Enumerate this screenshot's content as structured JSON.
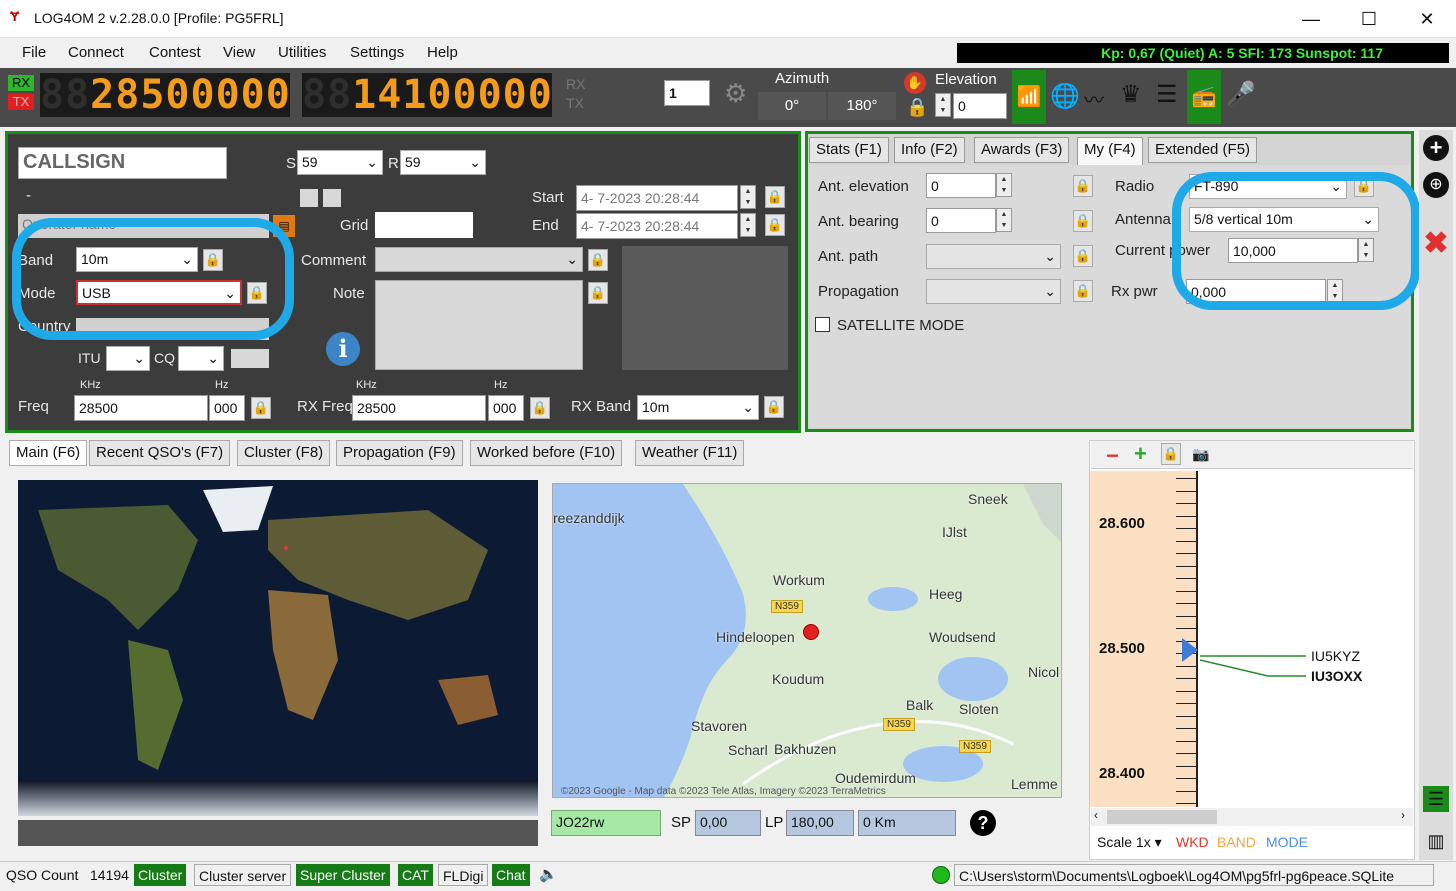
{
  "window": {
    "title": "LOG4OM 2 v.2.28.0.0 [Profile: PG5FRL]",
    "minimize": "—",
    "maximize": "☐",
    "close": "✕"
  },
  "menu": [
    "File",
    "Connect",
    "Contest",
    "View",
    "Utilities",
    "Settings",
    "Help"
  ],
  "propagation_bar": "Kp: 0,67 (Quiet)  A: 5  SFI: 173 Sunspot: 117",
  "radio": {
    "rx_label": "RX",
    "tx_label": "TX",
    "rx_freq_ghost": "88",
    "rx_freq": "28500000",
    "tx_freq_ghost": "88",
    "tx_freq": "14100000",
    "rx_indicator": "RX",
    "tx_indicator": "TX",
    "radio_number": "1",
    "azimuth_label": "Azimuth",
    "azimuth_sp": "0°",
    "azimuth_lp": "180°",
    "elevation_label": "Elevation",
    "elevation_value": "0"
  },
  "qso": {
    "callsign_placeholder": "CALLSIGN",
    "s_label": "S",
    "s_value": "59",
    "r_label": "R",
    "r_value": "59",
    "dash": "-",
    "name_placeholder": "Operator name",
    "grid_label": "Grid",
    "start_label": "Start",
    "start_value": "4- 7-2023 20:28:44",
    "end_label": "End",
    "end_value": "4- 7-2023 20:28:44",
    "band_label": "Band",
    "band_value": "10m",
    "mode_label": "Mode",
    "mode_value": "USB",
    "country_label": "Country",
    "comment_label": "Comment",
    "note_label": "Note",
    "itu_label": "ITU",
    "cq_label": "CQ",
    "khz_label": "KHz",
    "hz_label": "Hz",
    "freq_label": "Freq",
    "freq_khz": "28500",
    "freq_hz": "000",
    "rx_freq_label": "RX Freq",
    "rx_freq_khz": "28500",
    "rx_freq_hz": "000",
    "rx_band_label": "RX Band",
    "rx_band_value": "10m"
  },
  "right_tabs": [
    "Stats (F1)",
    "Info (F2)",
    "Awards (F3)",
    "My (F4)",
    "Extended (F5)"
  ],
  "my_tab": {
    "ant_elevation_label": "Ant. elevation",
    "ant_elevation_value": "0",
    "ant_bearing_label": "Ant. bearing",
    "ant_bearing_value": "0",
    "ant_path_label": "Ant. path",
    "propagation_label": "Propagation",
    "radio_label": "Radio",
    "radio_value": "FT-890",
    "antenna_label": "Antenna",
    "antenna_value": "5/8 vertical 10m",
    "current_power_label": "Current power",
    "current_power_value": "10,000",
    "rx_pwr_label": "Rx pwr",
    "rx_pwr_value": "0,000",
    "satellite_label": "SATELLITE MODE"
  },
  "bottom_tabs": [
    "Main (F6)",
    "Recent QSO's (F7)",
    "Cluster (F8)",
    "Propagation (F9)",
    "Worked before (F10)",
    "Weather (F11)"
  ],
  "map": {
    "towns": [
      "Sneek",
      "reezanddijk",
      "IJlst",
      "Workum",
      "Heeg",
      "Hindeloopen",
      "Woudsend",
      "Koudum",
      "Nicol",
      "Balk",
      "Sloten",
      "Stavoren",
      "Scharl",
      "Bakhuzen",
      "Oudemirdum",
      "Lemme"
    ],
    "roads": [
      "N359",
      "N359",
      "N359"
    ],
    "attribution": "©2023 Google - Map data ©2023 Tele Atlas, Imagery ©2023 TerraMetrics",
    "locator": "JO22rw",
    "sp_label": "SP",
    "sp_value": "0,00",
    "lp_label": "LP",
    "lp_value": "180,00",
    "distance": "0 Km"
  },
  "bandmap": {
    "freqs": [
      "28.600",
      "28.500",
      "28.400"
    ],
    "spots": [
      "IU5KYZ",
      "IU3OXX"
    ],
    "scale_label": "Scale 1x",
    "wkd": "WKD",
    "band": "BAND",
    "mode": "MODE",
    "colors": {
      "wkd": "#e8332a",
      "band": "#f3a640",
      "mode": "#4a90e2"
    }
  },
  "status": {
    "qso_count_label": "QSO Count",
    "qso_count": "14194",
    "cluster": "Cluster",
    "cluster_server": "Cluster server",
    "super_cluster": "Super Cluster",
    "cat": "CAT",
    "fldigi": "FLDigi",
    "chat": "Chat",
    "path": "C:\\Users\\storm\\Documents\\Logboek\\Log4OM\\pg5frl-pg6peace.SQLite"
  },
  "colors": {
    "accent_green": "#1a8a1a",
    "led_orange": "#f39b1a",
    "highlight_blue": "#1ea9e8"
  }
}
